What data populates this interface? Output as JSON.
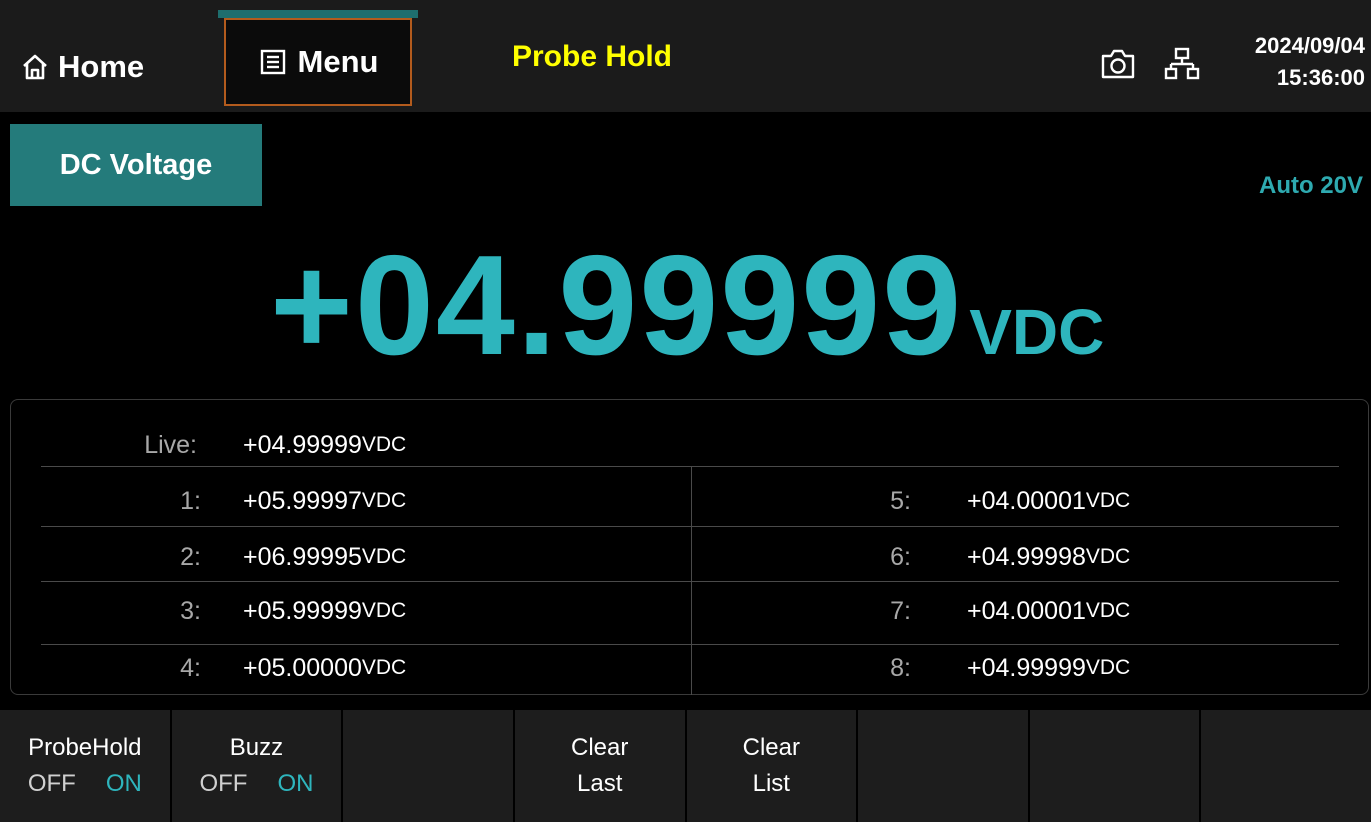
{
  "topbar": {
    "home_label": "Home",
    "menu_label": "Menu",
    "title": "Probe Hold",
    "date": "2024/09/04",
    "time": "15:36:00",
    "icons": [
      "home-icon",
      "menu-list-icon",
      "camera-icon",
      "network-icon"
    ]
  },
  "measurement": {
    "function": "DC Voltage",
    "range": "Auto 20V",
    "value": "+04.99999",
    "unit": "VDC"
  },
  "history": {
    "live_label": "Live:",
    "live_value": "+04.99999",
    "unit": "VDC",
    "left": [
      {
        "label": "1:",
        "value": "+05.99997"
      },
      {
        "label": "2:",
        "value": "+06.99995"
      },
      {
        "label": "3:",
        "value": "+05.99999"
      },
      {
        "label": "4:",
        "value": "+05.00000"
      }
    ],
    "right": [
      {
        "label": "5:",
        "value": "+04.00001"
      },
      {
        "label": "6:",
        "value": "+04.99998"
      },
      {
        "label": "7:",
        "value": "+04.00001"
      },
      {
        "label": "8:",
        "value": "+04.99999"
      }
    ]
  },
  "softkeys": {
    "probehold": {
      "label": "ProbeHold",
      "off": "OFF",
      "on": "ON",
      "selected": "ON"
    },
    "buzz": {
      "label": "Buzz",
      "off": "OFF",
      "on": "ON",
      "selected": "ON"
    },
    "clear_last": {
      "line1": "Clear",
      "line2": "Last"
    },
    "clear_list": {
      "line1": "Clear",
      "line2": "List"
    }
  },
  "colors": {
    "accent": "#2eb5bd",
    "tag_bg": "#247b7b",
    "title": "#ffff00",
    "menu_border": "#b35b1d"
  }
}
